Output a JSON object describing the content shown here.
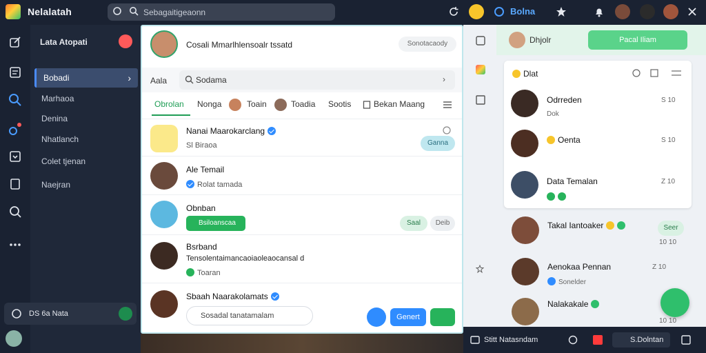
{
  "app": {
    "title": "Nelalatah"
  },
  "top_search": {
    "value": "Sebagaitigeaonn"
  },
  "top_brand": "Bolna",
  "nav": {
    "header": "Lata Atopati",
    "items": [
      {
        "label": "Bobadi",
        "active": true
      },
      {
        "label": "Marhaoa"
      },
      {
        "label": "Denina"
      },
      {
        "label": "Nhatlanch"
      },
      {
        "label": "Colet tjenan"
      },
      {
        "label": "Naejran"
      }
    ],
    "footer_label": "DS 6a Nata"
  },
  "center": {
    "header_title": "Cosali Mmarlhlensoalr tssatd",
    "header_pill": "Sonotacaody",
    "search_label": "Aala",
    "search_value": "Sodama",
    "tabs": [
      "Obrolan",
      "Nonga",
      "Toain",
      "Toadia",
      "Sootis",
      "Bekan Maang"
    ],
    "rows": [
      {
        "name": "Nanai Maarokarclang",
        "sub": "Sl Biraoa",
        "pill": "Ganna"
      },
      {
        "name": "Ale Temail",
        "sub": "Rolat tamada"
      },
      {
        "name": "Obnban",
        "green_label": "Bsiloanscaa",
        "pill1": "Saal",
        "pill2": "Deib"
      },
      {
        "name": "Bsrband",
        "sub": "Tensolentaimancaoiaoleaocansal d",
        "sub2": "Toaran"
      },
      {
        "name": "Sbaah Naarakolamats",
        "compose": "Sosadal tanatamalam"
      }
    ],
    "btn_blue": "Genert",
    "btn_green_icon": "send-icon"
  },
  "right": {
    "header_title": "Dhjolr",
    "header_button": "Pacal Iliam",
    "card_title": "Dlat",
    "card_rows": [
      {
        "name": "Odrreden",
        "meta": "Dok",
        "time": "S 10"
      },
      {
        "name": "Oenta",
        "time": "S 10"
      },
      {
        "name": "Data Temalan",
        "time": "Z 10"
      }
    ],
    "rows": [
      {
        "name": "Takal Iantoaker",
        "pill": "Seer",
        "time": "10 10"
      },
      {
        "name": "Aenokaa Pennan",
        "meta": "Sonelder",
        "time": "Z 10"
      },
      {
        "name": "Nalakakale",
        "time": "10 10"
      }
    ]
  },
  "bottom": {
    "label_left": "Stitt Natasndam",
    "label_right": "S.Dolntan"
  }
}
